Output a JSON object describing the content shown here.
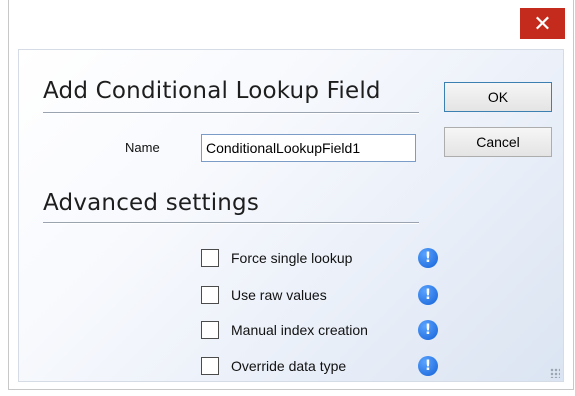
{
  "window": {
    "close_symbol": "✕"
  },
  "header": {
    "title": "Add Conditional Lookup Field"
  },
  "buttons": {
    "ok": "OK",
    "cancel": "Cancel"
  },
  "name_field": {
    "label": "Name",
    "value": "ConditionalLookupField1"
  },
  "advanced": {
    "title": "Advanced settings",
    "options": [
      {
        "label": "Force single lookup",
        "checked": false,
        "info_icon": "info-icon"
      },
      {
        "label": "Use raw values",
        "checked": false,
        "info_icon": "info-icon"
      },
      {
        "label": "Manual index creation",
        "checked": false,
        "info_icon": "info-icon"
      },
      {
        "label": "Override data type",
        "checked": false,
        "info_icon": "info-icon"
      }
    ]
  },
  "colors": {
    "close_bg": "#c42b1c",
    "info_blue": "#1461d6",
    "input_border": "#7a9cc6"
  }
}
